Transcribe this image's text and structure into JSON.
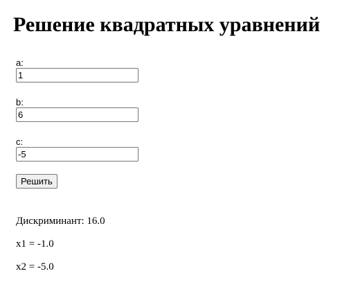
{
  "page": {
    "title": "Решение квадратных уравнений"
  },
  "form": {
    "a": {
      "label": "a:",
      "value": "1"
    },
    "b": {
      "label": "b:",
      "value": "6"
    },
    "c": {
      "label": "c:",
      "value": "-5"
    },
    "submit_label": "Решить"
  },
  "results": {
    "discriminant": "Дискриминант: 16.0",
    "x1": "x1 = -1.0",
    "x2": "x2 = -5.0"
  }
}
